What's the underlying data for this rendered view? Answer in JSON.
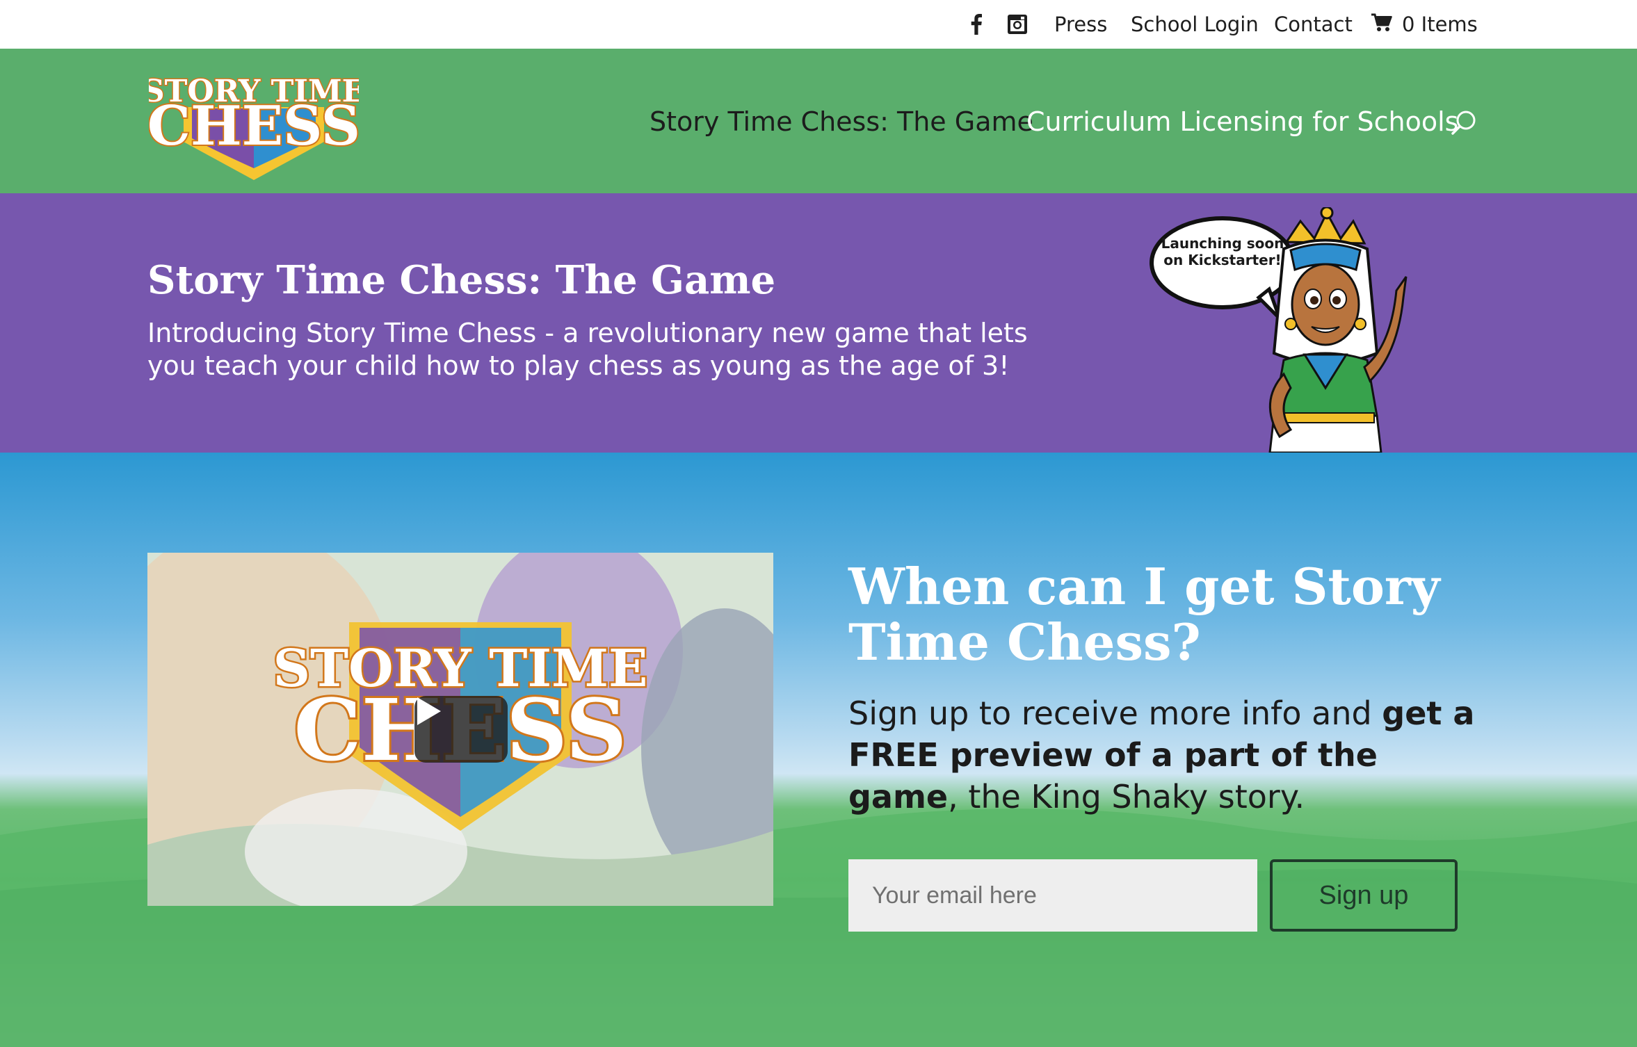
{
  "topbar": {
    "facebook_icon": "facebook-icon",
    "instagram_icon": "instagram-icon",
    "links": [
      "Press",
      "School Login",
      "Contact"
    ],
    "cart_icon": "cart-icon",
    "cart_label": "0 Items"
  },
  "header": {
    "logo": {
      "line1": "STORY TIME",
      "line2": "CHESS"
    },
    "nav": [
      "Story Time Chess: The Game",
      "Curriculum Licensing for Schools"
    ],
    "search_icon": "search-icon"
  },
  "band": {
    "title": "Story Time Chess: The Game",
    "subtitle": "Introducing Story Time Chess - a revolutionary new game that lets you teach your child how to play chess as young as the age of 3!",
    "bubble_text": "Launching soon on Kickstarter!"
  },
  "hero": {
    "video": {
      "logo_line1": "STORY TIME",
      "logo_line2": "CHESS",
      "play_icon": "play-icon"
    },
    "cta_title": "When can I get Story Time Chess?",
    "cta_text_prefix": "Sign up to receive more info and ",
    "cta_text_bold": "get a FREE preview of a part of the game",
    "cta_text_suffix": ", the King Shaky story.",
    "email_placeholder": "Your email here",
    "signup_label": "Sign up"
  },
  "colors": {
    "header_green": "#5aae6c",
    "band_purple": "#7757ae",
    "sky_blue": "#2c98d2",
    "signup_border": "#1e3a2a"
  }
}
